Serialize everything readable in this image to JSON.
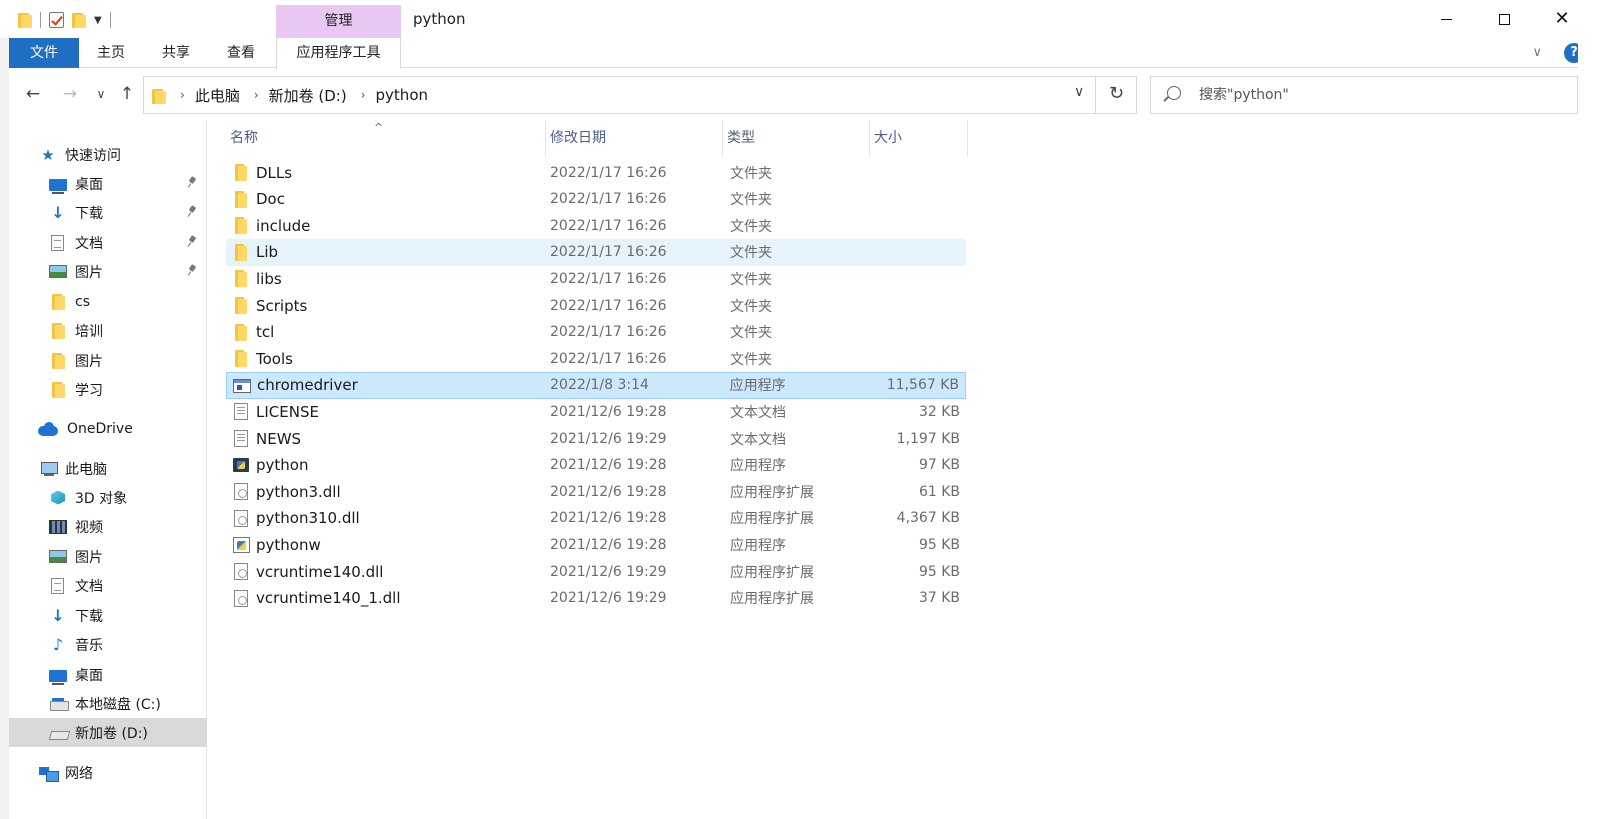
{
  "titlebar": {
    "manage_tab": "管理",
    "title": "python",
    "minimize": "minimize",
    "maximize": "maximize",
    "close": "✕"
  },
  "ribbon": {
    "tabs": [
      "文件",
      "主页",
      "共享",
      "查看",
      "应用程序工具"
    ],
    "expand": "∨",
    "help": "?"
  },
  "address": {
    "back": "←",
    "forward": "→",
    "recent": "∨",
    "up": "↑",
    "crumbs": [
      "此电脑",
      "新加卷 (D:)",
      "python"
    ],
    "dropdown": "∨",
    "refresh": "↻",
    "search_placeholder": "搜索\"python\""
  },
  "sidebar": {
    "items": [
      {
        "label": "快速访问",
        "icon": "star-icon"
      },
      {
        "label": "桌面",
        "icon": "desktop-icon",
        "pinned": true
      },
      {
        "label": "下载",
        "icon": "download-icon",
        "pinned": true
      },
      {
        "label": "文档",
        "icon": "document-icon",
        "pinned": true
      },
      {
        "label": "图片",
        "icon": "pictures-icon",
        "pinned": true
      },
      {
        "label": "cs",
        "icon": "folder-icon"
      },
      {
        "label": "培训",
        "icon": "folder-icon"
      },
      {
        "label": "图片",
        "icon": "folder-icon"
      },
      {
        "label": "学习",
        "icon": "folder-icon"
      },
      {
        "label": "OneDrive",
        "icon": "cloud-icon"
      },
      {
        "label": "此电脑",
        "icon": "pc-icon"
      },
      {
        "label": "3D 对象",
        "icon": "3d-objects-icon"
      },
      {
        "label": "视频",
        "icon": "video-icon"
      },
      {
        "label": "图片",
        "icon": "pictures-icon"
      },
      {
        "label": "文档",
        "icon": "document-icon"
      },
      {
        "label": "下载",
        "icon": "download-icon"
      },
      {
        "label": "音乐",
        "icon": "music-icon"
      },
      {
        "label": "桌面",
        "icon": "desktop-icon"
      },
      {
        "label": "本地磁盘 (C:)",
        "icon": "drive-icon"
      },
      {
        "label": "新加卷 (D:)",
        "icon": "drive-icon",
        "selected": true
      },
      {
        "label": "网络",
        "icon": "network-icon"
      }
    ]
  },
  "columns": {
    "name": "名称",
    "date": "修改日期",
    "type": "类型",
    "size": "大小",
    "sort_indicator": "^"
  },
  "files": [
    {
      "name": "DLLs",
      "date": "2022/1/17 16:26",
      "type": "文件夹",
      "size": "",
      "icon": "folder-icon"
    },
    {
      "name": "Doc",
      "date": "2022/1/17 16:26",
      "type": "文件夹",
      "size": "",
      "icon": "folder-icon"
    },
    {
      "name": "include",
      "date": "2022/1/17 16:26",
      "type": "文件夹",
      "size": "",
      "icon": "folder-icon"
    },
    {
      "name": "Lib",
      "date": "2022/1/17 16:26",
      "type": "文件夹",
      "size": "",
      "icon": "folder-icon",
      "state": "hover"
    },
    {
      "name": "libs",
      "date": "2022/1/17 16:26",
      "type": "文件夹",
      "size": "",
      "icon": "folder-icon"
    },
    {
      "name": "Scripts",
      "date": "2022/1/17 16:26",
      "type": "文件夹",
      "size": "",
      "icon": "folder-icon"
    },
    {
      "name": "tcl",
      "date": "2022/1/17 16:26",
      "type": "文件夹",
      "size": "",
      "icon": "folder-icon"
    },
    {
      "name": "Tools",
      "date": "2022/1/17 16:26",
      "type": "文件夹",
      "size": "",
      "icon": "folder-icon"
    },
    {
      "name": "chromedriver",
      "date": "2022/1/8 3:14",
      "type": "应用程序",
      "size": "11,567 KB",
      "icon": "exe-icon",
      "state": "selected"
    },
    {
      "name": "LICENSE",
      "date": "2021/12/6 19:28",
      "type": "文本文档",
      "size": "32 KB",
      "icon": "text-file-icon"
    },
    {
      "name": "NEWS",
      "date": "2021/12/6 19:29",
      "type": "文本文档",
      "size": "1,197 KB",
      "icon": "text-file-icon"
    },
    {
      "name": "python",
      "date": "2021/12/6 19:28",
      "type": "应用程序",
      "size": "97 KB",
      "icon": "python-icon"
    },
    {
      "name": "python3.dll",
      "date": "2021/12/6 19:28",
      "type": "应用程序扩展",
      "size": "61 KB",
      "icon": "dll-icon"
    },
    {
      "name": "python310.dll",
      "date": "2021/12/6 19:28",
      "type": "应用程序扩展",
      "size": "4,367 KB",
      "icon": "dll-icon"
    },
    {
      "name": "pythonw",
      "date": "2021/12/6 19:28",
      "type": "应用程序",
      "size": "95 KB",
      "icon": "pythonw-icon"
    },
    {
      "name": "vcruntime140.dll",
      "date": "2021/12/6 19:29",
      "type": "应用程序扩展",
      "size": "95 KB",
      "icon": "dll-icon"
    },
    {
      "name": "vcruntime140_1.dll",
      "date": "2021/12/6 19:29",
      "type": "应用程序扩展",
      "size": "37 KB",
      "icon": "dll-icon"
    }
  ],
  "colors": {
    "file_tab": "#1f6fc5",
    "manage_tab": "#e8c8f2",
    "selected_row": "#cce8ff",
    "hover_row": "#e5f3fb",
    "accent_blue": "#1f73d2",
    "folder_yellow": "#ffd866"
  }
}
